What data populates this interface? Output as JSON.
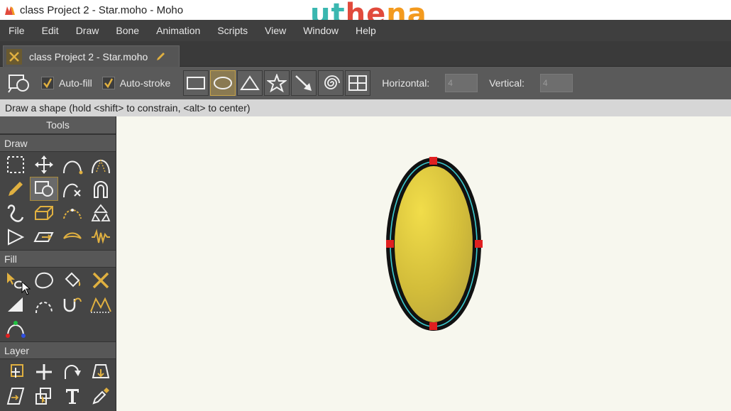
{
  "window": {
    "title": "class Project 2 - Star.moho - Moho"
  },
  "watermark": {
    "part1": "ut",
    "part2": "he",
    "part3": "na"
  },
  "menu": [
    "File",
    "Edit",
    "Draw",
    "Bone",
    "Animation",
    "Scripts",
    "View",
    "Window",
    "Help"
  ],
  "tab": {
    "label": "class Project 2 - Star.moho"
  },
  "tool_options": {
    "autofill_label": "Auto-fill",
    "autostroke_label": "Auto-stroke",
    "horizontal_label": "Horizontal:",
    "horizontal_value": "4",
    "vertical_label": "Vertical:",
    "vertical_value": "4",
    "shapes": [
      "rectangle-icon",
      "oval-icon",
      "triangle-icon",
      "star-icon",
      "arrow-icon",
      "spiral-icon",
      "grid-icon"
    ],
    "active_shape": "oval-icon"
  },
  "status": {
    "text": "Draw a shape (hold <shift> to constrain, <alt> to center)"
  },
  "tools_panel": {
    "title": "Tools",
    "draw_label": "Draw",
    "fill_label": "Fill",
    "layer_label": "Layer",
    "draw_tools": [
      "select-points-icon",
      "transform-points-icon",
      "add-point-icon",
      "curvature-icon",
      "freehand-icon",
      "draw-shape-icon",
      "delete-edge-icon",
      "magnet-icon",
      "scatter-brush-icon",
      "perspective-icon",
      "bend-icon",
      "noise-icon",
      "shear-icon",
      "sketch-icon",
      "curve-edge-icon",
      "wave-icon"
    ],
    "active_draw_tool": "draw-shape-icon",
    "fill_tools": [
      "select-shape-icon",
      "create-shape-icon",
      "paint-bucket-icon",
      "delete-shape-icon",
      "line-width-icon",
      "hide-edge-icon",
      "stroke-icon",
      "curve-profile-icon",
      "color-points-icon"
    ],
    "layer_tools": [
      "transform-layer-icon",
      "set-origin-icon",
      "rotate-layer-icon",
      "shear-layer-icon",
      "layer-skew-icon",
      "layer-move-icon",
      "text-icon",
      "eyedropper-icon"
    ]
  },
  "colors": {
    "accent": "#c9a54a",
    "fill": "#d8c43a",
    "stroke": "#111111",
    "curve": "#3ccbd0",
    "point": "#e02020"
  }
}
